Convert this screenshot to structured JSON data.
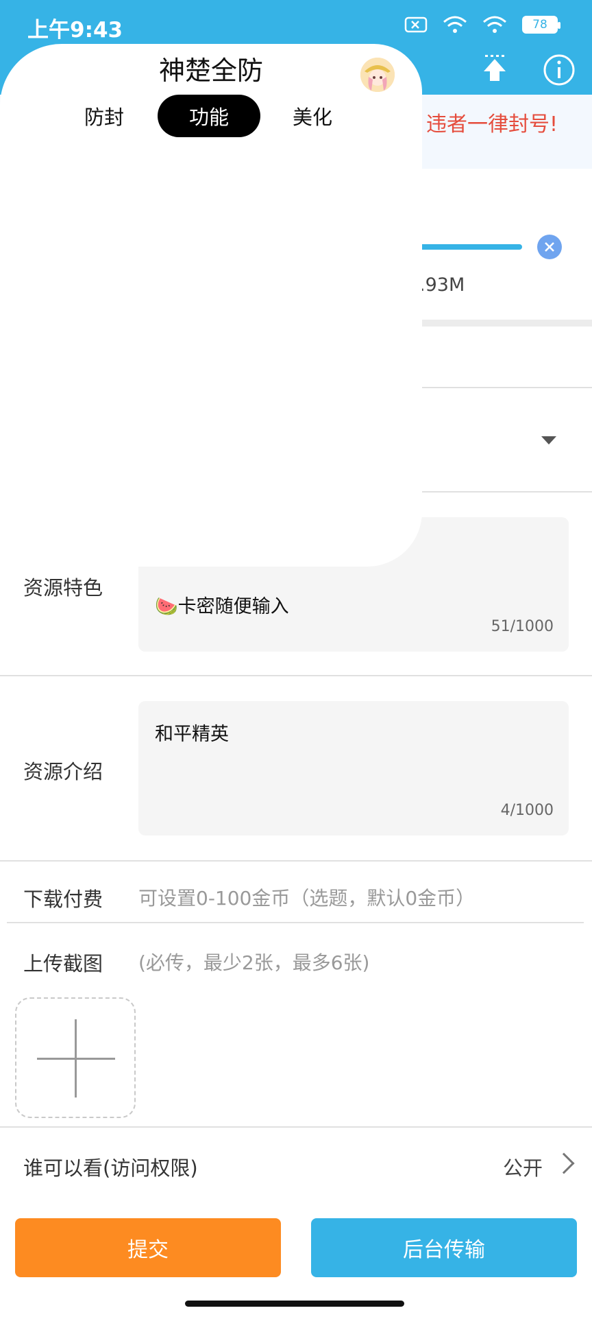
{
  "status_bar": {
    "time": "上午9:43",
    "battery": "78"
  },
  "announcement": {
    "text": "违者一律封号!"
  },
  "upload": {
    "size_text": ".93M"
  },
  "form": {
    "features": {
      "label": "资源特色",
      "value": "🍉卡密随便输入",
      "count": "51/1000"
    },
    "intro": {
      "label": "资源介绍",
      "value": "和平精英",
      "count": "4/1000"
    },
    "fee": {
      "label": "下载付费",
      "hint": "可设置0-100金币（选题，默认0金币）"
    },
    "screenshots": {
      "label": "上传截图",
      "hint": "(必传，最少2张，最多6张)"
    },
    "privacy": {
      "label": "谁可以看(访问权限)",
      "value": "公开"
    }
  },
  "buttons": {
    "submit": "提交",
    "background_transfer": "后台传输"
  },
  "panel": {
    "title": "神楚全防",
    "tabs": [
      "防封",
      "功能",
      "美化"
    ],
    "active_tab": "功能"
  },
  "colors": {
    "header": "#36b3e6",
    "submit": "#fd8b21",
    "warning": "#e54c3c"
  }
}
